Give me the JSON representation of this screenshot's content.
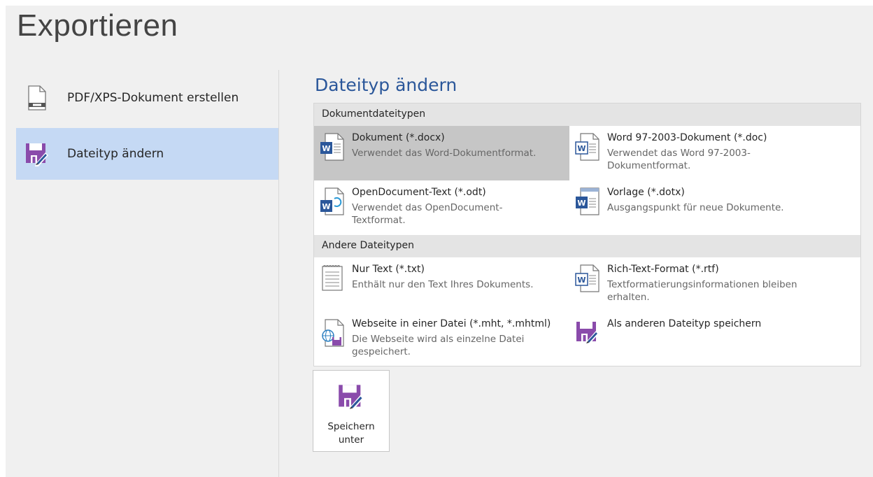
{
  "page": {
    "title": "Exportieren"
  },
  "nav": {
    "items": [
      {
        "label": "PDF/XPS-Dokument erstellen",
        "icon": "pdf-document-icon",
        "selected": false
      },
      {
        "label": "Dateityp ändern",
        "icon": "save-as-icon",
        "selected": true
      }
    ]
  },
  "content": {
    "title": "Dateityp ändern",
    "groups": [
      {
        "header": "Dokumentdateitypen"
      },
      {
        "header": "Andere Dateitypen"
      }
    ],
    "tiles": [
      {
        "title": "Dokument (*.docx)",
        "desc_line1": "Verwendet das Word-Dokumentformat.",
        "desc_line2": "",
        "icon": "word-docx-icon",
        "selected": true
      },
      {
        "title": "Word 97-2003-Dokument (*.doc)",
        "desc_line1": "Verwendet das Word 97-2003-",
        "desc_line2": "Dokumentformat.",
        "icon": "word-doc-icon",
        "selected": false
      },
      {
        "title": "OpenDocument-Text (*.odt)",
        "desc_line1": "Verwendet das OpenDocument-",
        "desc_line2": "Textformat.",
        "icon": "word-odt-icon",
        "selected": false
      },
      {
        "title": "Vorlage (*.dotx)",
        "desc_line1": "Ausgangspunkt für neue Dokumente.",
        "desc_line2": "",
        "icon": "word-template-icon",
        "selected": false
      },
      {
        "title": "Nur Text (*.txt)",
        "desc_line1": "Enthält nur den Text Ihres Dokuments.",
        "desc_line2": "",
        "icon": "plain-text-icon",
        "selected": false
      },
      {
        "title": "Rich-Text-Format (*.rtf)",
        "desc_line1": "Textformatierungsinformationen bleiben",
        "desc_line2": "erhalten.",
        "icon": "word-rtf-icon",
        "selected": false
      },
      {
        "title": "Webseite in einer Datei (*.mht, *.mhtml)",
        "desc_line1": "Die Webseite wird als einzelne Datei",
        "desc_line2": "gespeichert.",
        "icon": "web-page-icon",
        "selected": false
      },
      {
        "title": "Als anderen Dateityp speichern",
        "desc_line1": "",
        "desc_line2": "",
        "icon": "save-as-icon",
        "selected": false
      }
    ]
  },
  "save_button": {
    "label_line1": "Speichern",
    "label_line2": "unter",
    "icon": "save-as-icon"
  },
  "colors": {
    "accent": "#2b579a",
    "selected_nav": "#c5d9f4",
    "selected_tile": "#c6c6c6",
    "word_blue": "#2b579a",
    "purple": "#8a4bab"
  }
}
